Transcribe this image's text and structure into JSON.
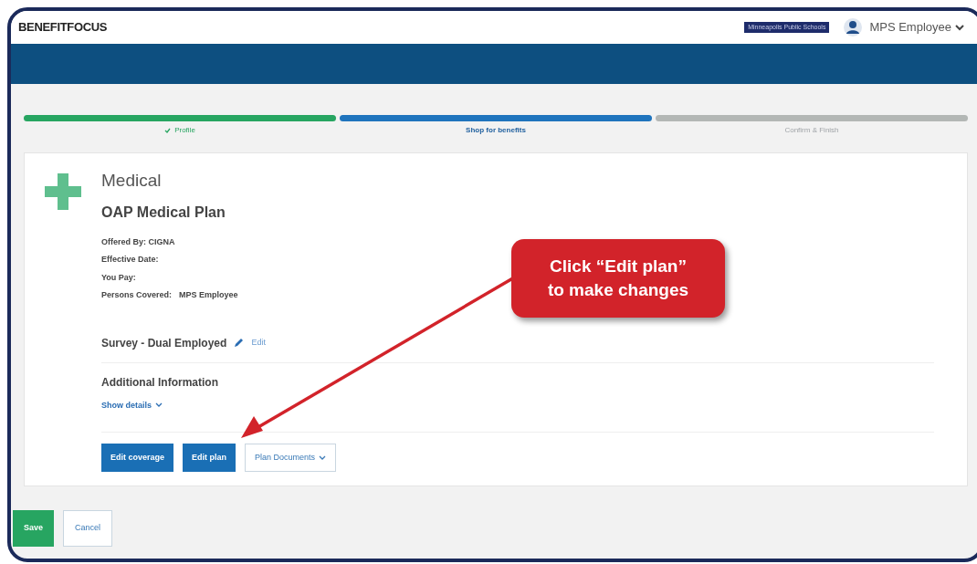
{
  "header": {
    "logo": "BENEFITFOCUS",
    "organization": "Minneapolis Public Schools",
    "user": "MPS Employee"
  },
  "steps": [
    {
      "label": "Profile",
      "kind": "complete"
    },
    {
      "label": "Shop for benefits",
      "kind": "current"
    },
    {
      "label": "Confirm & Finish",
      "kind": "upcoming"
    }
  ],
  "card": {
    "category": "Medical",
    "plan": "OAP Medical Plan",
    "details": [
      "Offered By: CIGNA",
      "Effective Date:",
      "You Pay:"
    ],
    "persons_label": "Persons Covered:",
    "persons_value": "MPS Employee",
    "survey": "Survey - Dual Employed",
    "survey_edit": "Edit",
    "additional_title": "Additional Information",
    "show_details": "Show details",
    "buttons": [
      {
        "label": "Edit coverage",
        "kind": "primary"
      },
      {
        "label": "Edit plan",
        "kind": "primary"
      },
      {
        "label": "Plan Documents",
        "kind": "dropdown"
      }
    ]
  },
  "footer_buttons": [
    {
      "label": "Save",
      "kind": "success"
    },
    {
      "label": "Cancel",
      "kind": "outline"
    }
  ],
  "callout": {
    "line1": "Click “Edit plan”",
    "line2": "to make changes"
  }
}
